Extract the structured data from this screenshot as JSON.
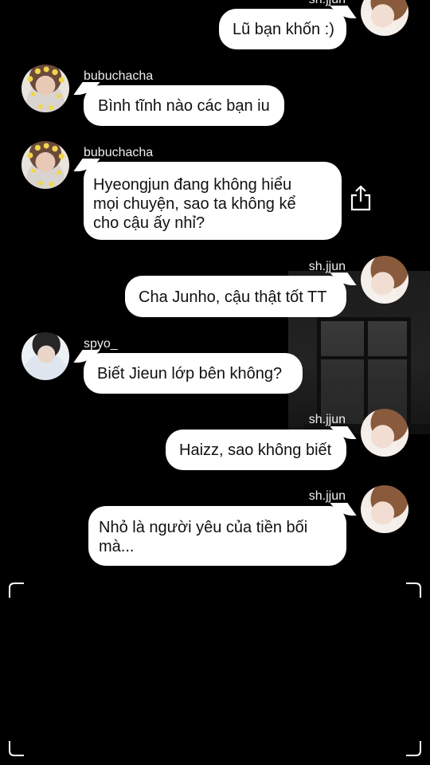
{
  "messages": [
    {
      "id": 1,
      "side": "right",
      "username": "sh.jjun",
      "text": "Lũ bạn khốn :)"
    },
    {
      "id": 2,
      "side": "left",
      "username": "bubuchacha",
      "text": "Bình tĩnh nào các bạn iu"
    },
    {
      "id": 3,
      "side": "left",
      "username": "bubuchacha",
      "text": "Hyeongjun đang không hiểu\nmọi chuyện, sao ta không kể\ncho cậu ấy nhỉ?"
    },
    {
      "id": 4,
      "side": "right",
      "username": "sh.jjun",
      "text": "Cha Junho, cậu thật tốt TT"
    },
    {
      "id": 5,
      "side": "left",
      "username": "spyo_",
      "text": "Biết Jieun lớp bên không?"
    },
    {
      "id": 6,
      "side": "right",
      "username": "sh.jjun",
      "text": "Haizz, sao không biết"
    },
    {
      "id": 7,
      "side": "right",
      "username": "sh.jjun",
      "text": " Nhỏ là người yêu của tiền bối\nmà..."
    }
  ],
  "icons": {
    "share": "share-icon",
    "frame_corners": "viewfinder-corner-icon"
  },
  "colors": {
    "background": "#000000",
    "bubble": "#ffffff",
    "text": "#111111",
    "username": "#eeeeee"
  }
}
